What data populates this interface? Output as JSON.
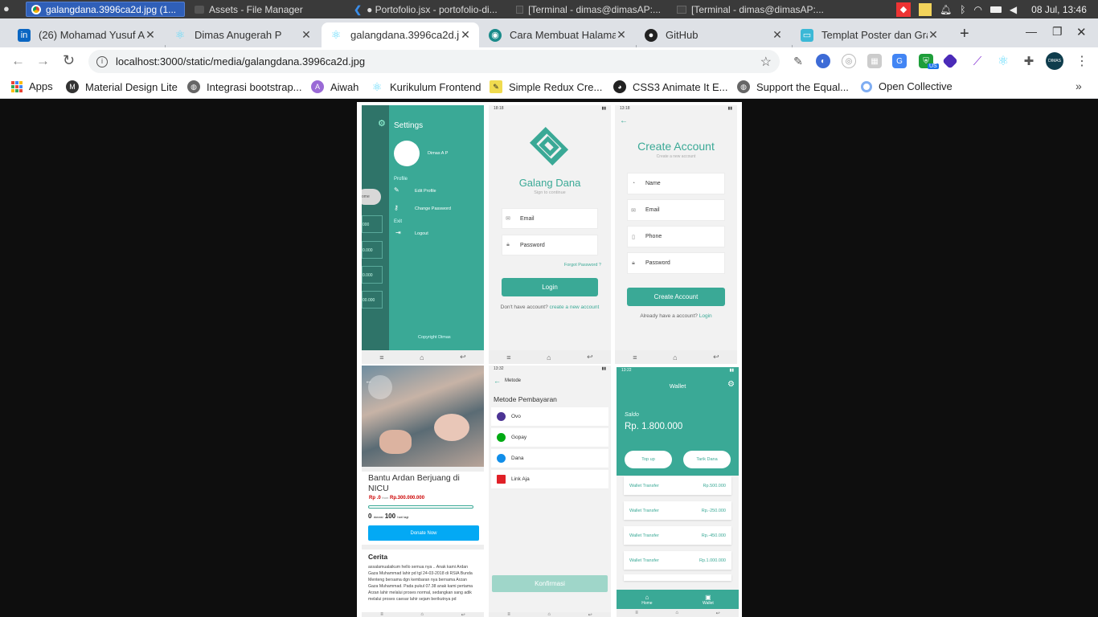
{
  "system_bar": {
    "tasks": [
      {
        "label": "galangdana.3996ca2d.jpg (1...",
        "active": true
      },
      {
        "label": "Assets - File Manager",
        "active": false
      },
      {
        "label": "● Portofolio.jsx - portofolio-di...",
        "active": false
      },
      {
        "label": "[Terminal - dimas@dimasAP:...",
        "active": false
      },
      {
        "label": "[Terminal - dimas@dimasAP:...",
        "active": false
      }
    ],
    "clock": "08 Jul, 13:46"
  },
  "tabs": [
    {
      "title": "(26) Mohamad Yusuf Ac",
      "icon": "linkedin-icon"
    },
    {
      "title": "Dimas Anugerah P",
      "icon": "react-icon"
    },
    {
      "title": "galangdana.3996ca2d.j",
      "icon": "react-icon",
      "current": true
    },
    {
      "title": "Cara Membuat Halama",
      "icon": "globe-icon"
    },
    {
      "title": "GitHub",
      "icon": "github-icon"
    },
    {
      "title": "Templat Poster dan Gra",
      "icon": "canva-icon"
    }
  ],
  "toolbar": {
    "url": "localhost:3000/static/media/galangdana.3996ca2d.jpg",
    "ext_badge": "US",
    "profile": "DIMAS"
  },
  "bookmarks": [
    {
      "label": "Apps",
      "icon": "apps-grid-icon"
    },
    {
      "label": "Material Design Lite",
      "icon": "mdl-icon"
    },
    {
      "label": "Integrasi bootstrap...",
      "icon": "globe-icon"
    },
    {
      "label": "Aiwah",
      "icon": "aiwah-icon"
    },
    {
      "label": "Kurikulum Frontend",
      "icon": "react-icon"
    },
    {
      "label": "Simple Redux Cre...",
      "icon": "js-icon"
    },
    {
      "label": "CSS3 Animate It E...",
      "icon": "ninja-icon"
    },
    {
      "label": "Support the Equal...",
      "icon": "globe-icon"
    },
    {
      "label": "Open Collective",
      "icon": "opencollective-icon"
    }
  ],
  "screens": {
    "settings": {
      "title": "Settings",
      "user": "Dimas A P",
      "section_profile": "Profile",
      "edit_profile": "Edit Profile",
      "change_password": "Change Password",
      "section_exit": "Exit",
      "logout": "Logout",
      "copyright": "Copyright Dimas",
      "peek": [
        "ome",
        "000",
        "0.000",
        "0.000",
        "00.000"
      ]
    },
    "login": {
      "time": "18:18",
      "brand": "Galang Dana",
      "subtitle": "Sign to continue",
      "email": "Email",
      "password": "Password",
      "forgot": "Forgot Password ?",
      "login_btn": "Login",
      "no_account": "Don't have account?",
      "create_link": "create a new account"
    },
    "register": {
      "time": "13:18",
      "title": "Create Account",
      "subtitle": "Create a new account",
      "name": "Name",
      "email": "Email",
      "phone": "Phone",
      "password": "Password",
      "create_btn": "Create Account",
      "have_account": "Already have a account?",
      "login_link": "Login"
    },
    "campaign": {
      "title": "Bantu Ardan Berjuang di NICU",
      "raised": "Rp .0",
      "from": "from",
      "target": "Rp.300.000.000",
      "donors": "0",
      "donors_label": "donasi",
      "days": "100",
      "days_label": "hari lagi",
      "donate_btn": "Donate Now",
      "story_title": "Cerita",
      "story": "assalamualaikum hello semua nya .. Anak kami Ardan Gaza Muhammad lahir pd tgl 24-03-2018 di RSIA Bunda Menteng bersama dgn kembaran nya bernama Arzan Gaza Muhammad. Pada pukul 07.38 anak kami pertama Arzan lahir melalui proses normal, sedangkan sang adik melalui proses caesar lahir sejam berikutnya pd"
    },
    "payment": {
      "time": "13:32",
      "header": "Metode",
      "title": "Metode Pembayaran",
      "methods": [
        "Ovo",
        "Gopay",
        "Dana",
        "Link Aja"
      ],
      "confirm_btn": "Konfirmasi"
    },
    "wallet": {
      "time": "13:22",
      "header": "Wallet",
      "saldo_label": "Saldo",
      "saldo": "Rp. 1.800.000",
      "topup": "Top up",
      "tarik": "Tarik Dana",
      "transactions": [
        {
          "label": "Wallet Transfer",
          "amount": "Rp.500.000"
        },
        {
          "label": "Wallet Transfer",
          "amount": "Rp.-250.000"
        },
        {
          "label": "Wallet Transfer",
          "amount": "Rp.-450.000"
        },
        {
          "label": "Wallet Transfer",
          "amount": "Rp.1.000.000"
        }
      ],
      "nav_home": "Home",
      "nav_wallet": "Wallet"
    }
  }
}
